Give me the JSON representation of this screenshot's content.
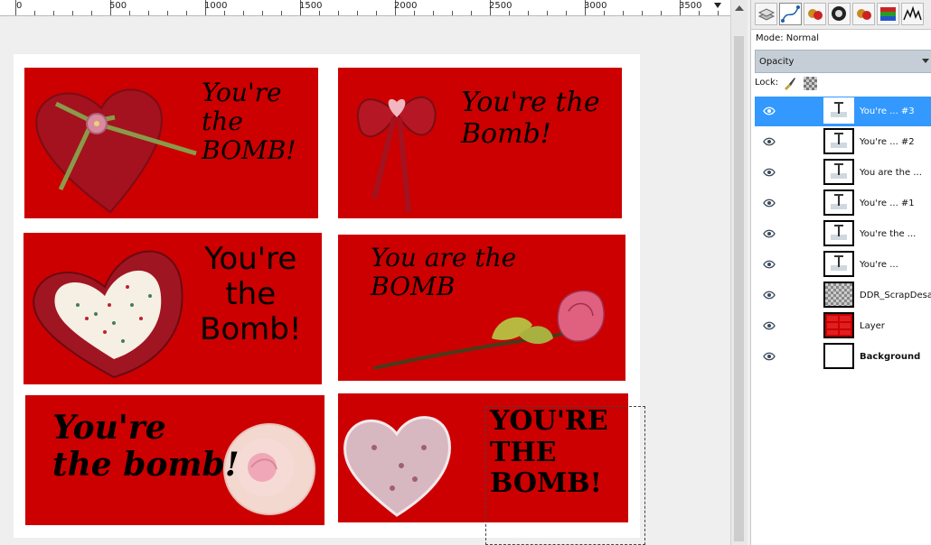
{
  "ruler": {
    "labels": [
      "0",
      "500",
      "1000",
      "1500",
      "2000",
      "2500",
      "3000",
      "3500"
    ]
  },
  "cards": [
    {
      "text": "You're\nthe\nBOMB!",
      "bg": "#cc0000"
    },
    {
      "text": "You're the\nBomb!",
      "bg": "#cc0000"
    },
    {
      "text": "You're\nthe\nBomb!",
      "bg": "#cc0000"
    },
    {
      "text": "You are the\nBOMB",
      "bg": "#cc0000"
    },
    {
      "text": "You're\nthe bomb!",
      "bg": "#cc0000"
    },
    {
      "text": "YOU'RE\nTHE\nBOMB!",
      "bg": "#cc0000"
    }
  ],
  "layers_panel": {
    "tabs": [
      "channels-icon",
      "paths-icon",
      "brushes-icon",
      "gradient-icon",
      "patterns-icon",
      "palettes-icon",
      "histogram-icon"
    ],
    "mode_label": "Mode: Normal",
    "opacity_label": "Opacity",
    "lock_label": "Lock:",
    "layers": [
      {
        "name": "You're ... #3",
        "type": "text",
        "selected": true
      },
      {
        "name": "You're ... #2",
        "type": "text",
        "selected": false
      },
      {
        "name": "You are the ...",
        "type": "text",
        "selected": false
      },
      {
        "name": "You're ... #1",
        "type": "text",
        "selected": false
      },
      {
        "name": "You're the ...",
        "type": "text",
        "selected": false
      },
      {
        "name": "You're ...",
        "type": "text",
        "selected": false
      },
      {
        "name": "DDR_ScrapDesafio",
        "type": "image",
        "selected": false
      },
      {
        "name": "Layer",
        "type": "red",
        "selected": false
      },
      {
        "name": "Background",
        "type": "white",
        "selected": false
      }
    ]
  },
  "colors": {
    "card_red": "#cc0000",
    "selection_blue": "#3399ff"
  }
}
